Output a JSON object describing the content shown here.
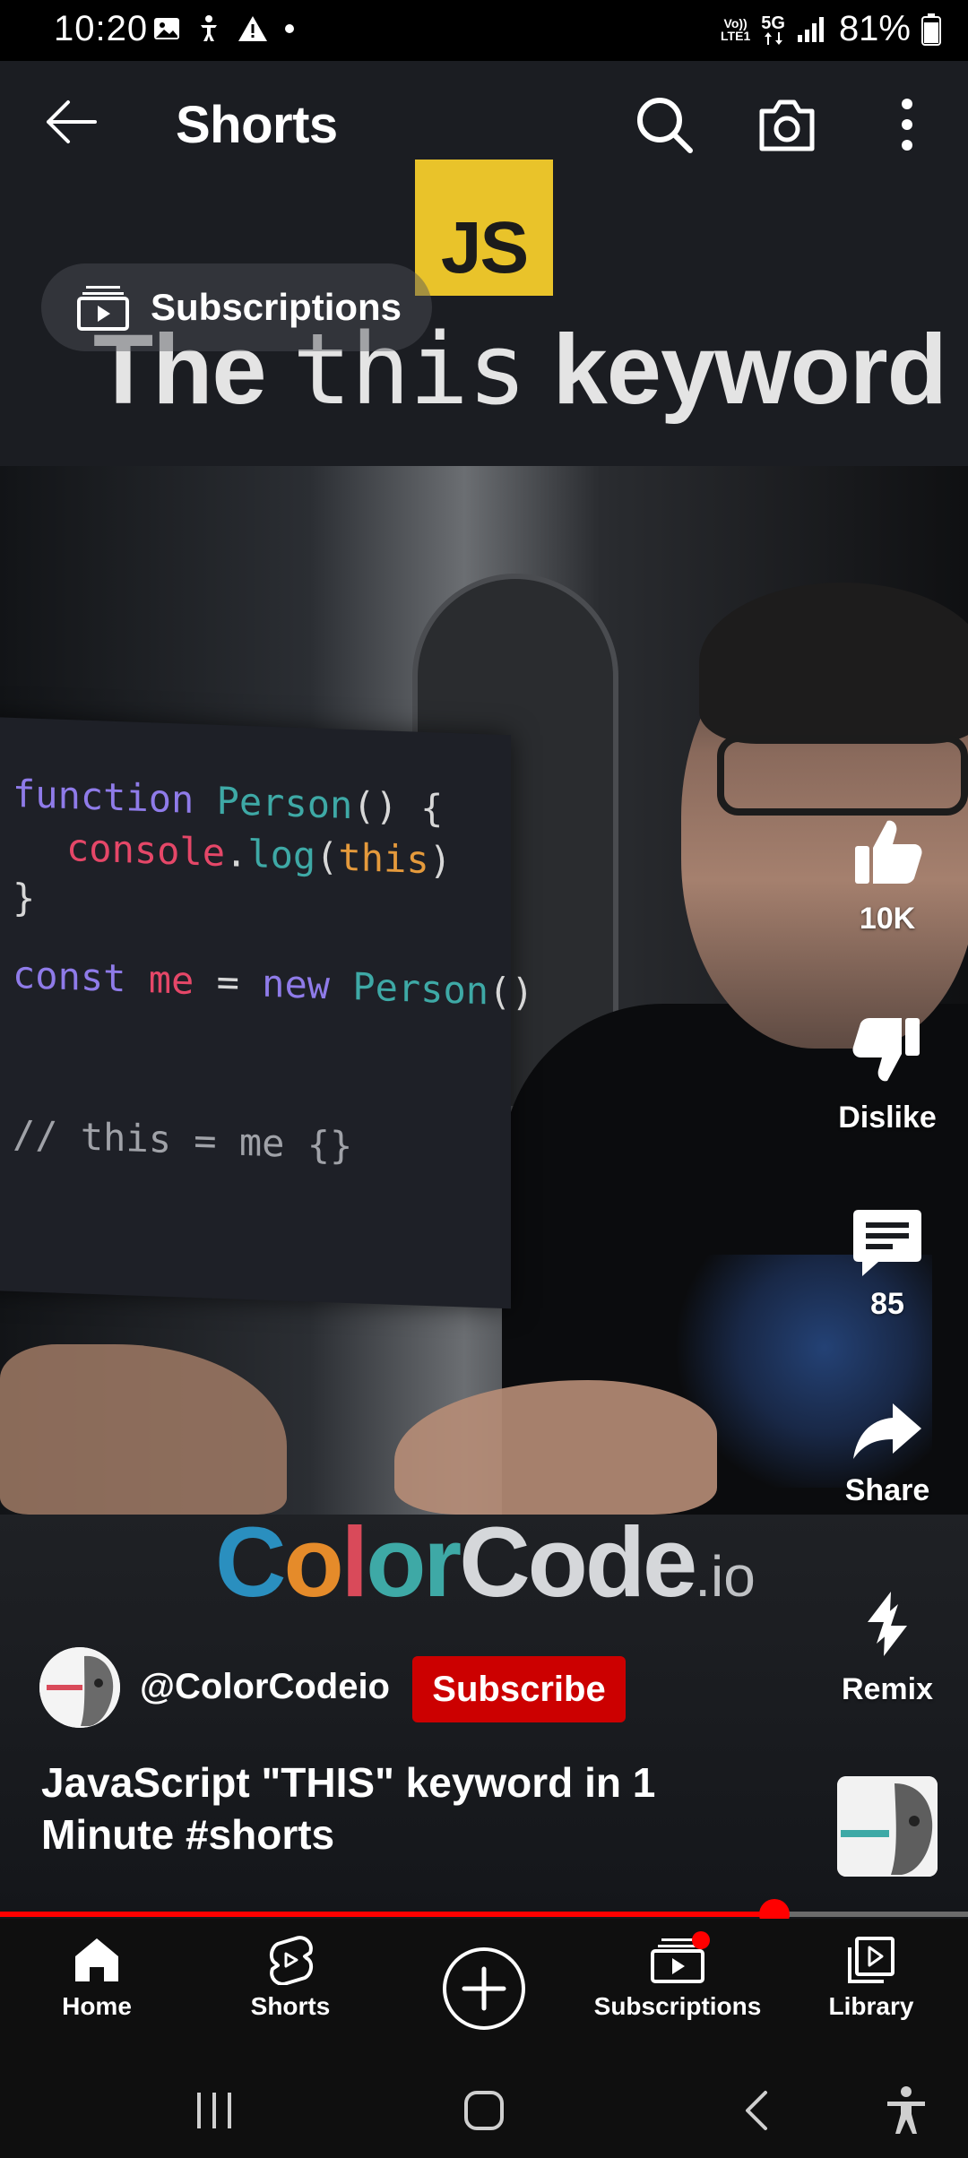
{
  "status_bar": {
    "time": "10:20",
    "network_top": "Vo))",
    "network_bottom": "LTE1",
    "network_5g": "5G",
    "battery": "81%"
  },
  "app_bar": {
    "title": "Shorts"
  },
  "video": {
    "overlay_title_1": "The ",
    "overlay_title_code": "this",
    "overlay_title_2": " keyword",
    "js_badge": "JS",
    "code": {
      "line1_kw": "function",
      "line1_fn": "Person",
      "line1_rest": "() {",
      "line2_obj": "console",
      "line2_dot": ".",
      "line2_fn": "log",
      "line2_open": "(",
      "line2_arg": "this",
      "line2_close": ")",
      "line3": "}",
      "line4_kw": "const",
      "line4_var": "me",
      "line4_eq": " = ",
      "line4_new": "new",
      "line4_fn": "Person",
      "line4_rest": "()",
      "line5": "// this = me {}"
    },
    "brand_color": "Color",
    "brand_code": "Code",
    "brand_io": ".io"
  },
  "chip": {
    "label": "Subscriptions"
  },
  "actions": {
    "like_count": "10K",
    "dislike_label": "Dislike",
    "comments_count": "85",
    "share_label": "Share",
    "remix_label": "Remix"
  },
  "channel": {
    "handle": "@ColorCodeio",
    "subscribe_label": "Subscribe"
  },
  "short_title": "JavaScript \"THIS\" keyword in 1 Minute #shorts",
  "progress": {
    "fraction": 0.8
  },
  "bottom_nav": {
    "home": "Home",
    "shorts": "Shorts",
    "subscriptions": "Subscriptions",
    "library": "Library"
  },
  "colors": {
    "accent": "#ff0000",
    "subscribe": "#cc0000",
    "js_yellow": "#e9c32a"
  }
}
